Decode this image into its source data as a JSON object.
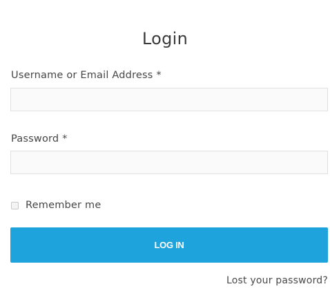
{
  "form": {
    "title": "Login",
    "username": {
      "label": "Username or Email Address *",
      "value": "",
      "placeholder": ""
    },
    "password": {
      "label": "Password *",
      "value": "",
      "placeholder": ""
    },
    "remember": {
      "label": "Remember me",
      "checked": false
    },
    "submit_label": "LOG IN",
    "lost_password_label": "Lost your password?"
  },
  "colors": {
    "button_bg": "#1ea3dc",
    "button_text": "#ffffff",
    "input_border": "#e0e0e0",
    "text": "#454545"
  }
}
